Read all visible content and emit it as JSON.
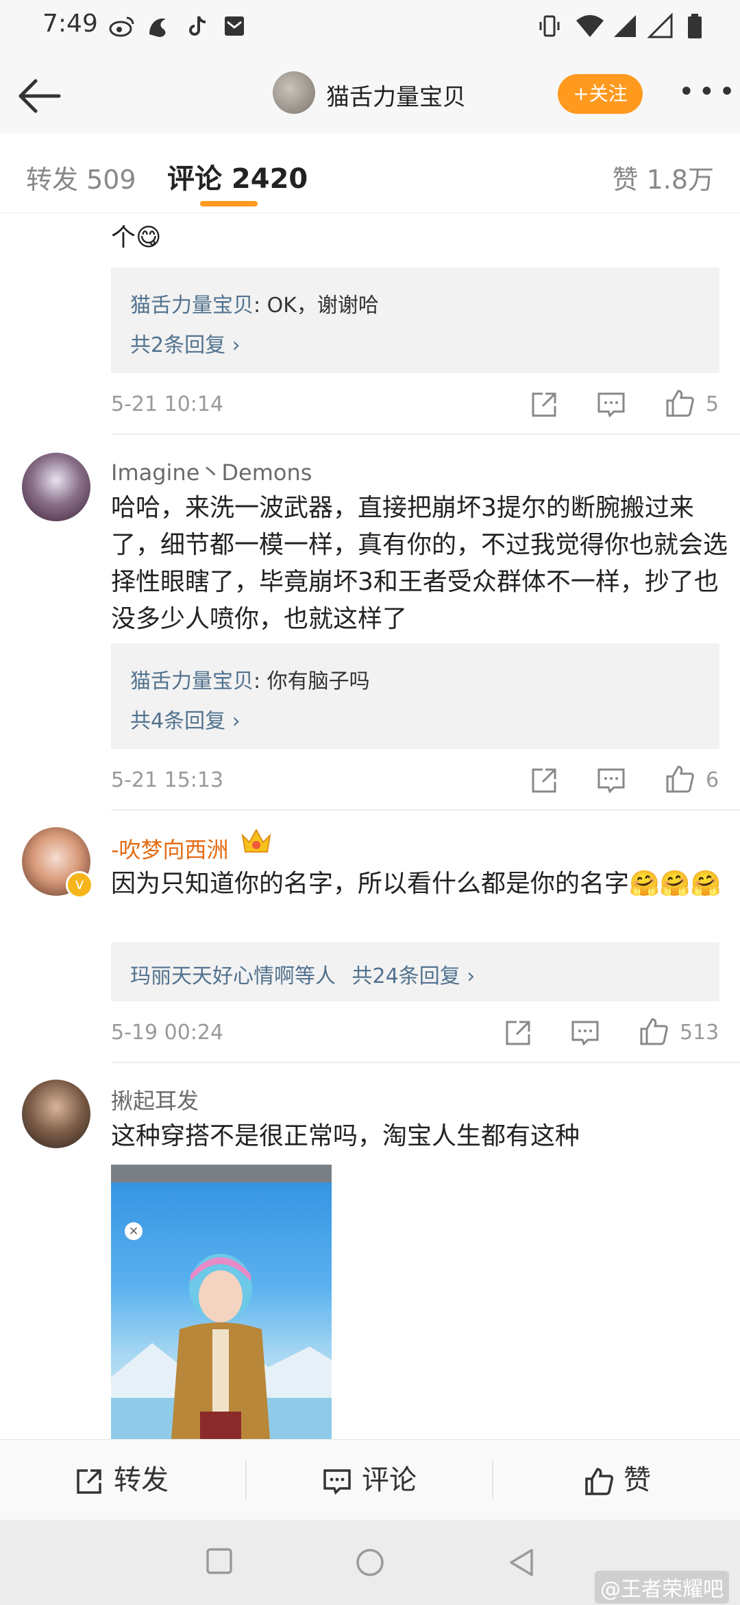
{
  "status_bar": {
    "time": "7:49",
    "icons": [
      "weibo-icon",
      "uc-icon",
      "tiktok-icon",
      "mail-icon",
      "vibrate-icon",
      "wifi-icon",
      "signal-icon",
      "signal-empty-icon",
      "battery-icon"
    ]
  },
  "header": {
    "title": "猫舌力量宝贝",
    "follow_label": "+关注",
    "more_label": "•••"
  },
  "tabs": {
    "repost": "转发 509",
    "comment": "评论 2420",
    "likes": "赞 1.8万"
  },
  "accent_color": "#ff9a1f",
  "link_color": "#52728f",
  "comments": [
    {
      "text_partial": "个😋",
      "reply_user": "猫舌力量宝贝",
      "reply_text": ": OK，谢谢哈",
      "reply_more": "共2条回复 ›",
      "date": "5-21 10:14",
      "likes": "5"
    },
    {
      "name": "Imagine丶Demons",
      "text": "哈哈，来洗一波武器，直接把崩坏3提尔的断腕搬过来了，细节都一模一样，真有你的，不过我觉得你也就会选择性眼瞎了，毕竟崩坏3和王者受众群体不一样，抄了也没多少人喷你，也就这样了",
      "reply_user": "猫舌力量宝贝",
      "reply_text": ": 你有脑子吗",
      "reply_more": "共4条回复 ›",
      "date": "5-21 15:13",
      "likes": "6"
    },
    {
      "name": "-吹梦向西洲",
      "text": "因为只知道你的名字，所以看什么都是你的名字🤗🤗🤗",
      "reply_summary_user": "玛丽天天好心情啊",
      "reply_summary_mid": "等人",
      "reply_more": "共24条回复 ›",
      "date": "5-19 00:24",
      "likes": "513"
    },
    {
      "name": "揪起耳发",
      "text": "这种穿搭不是很正常吗，淘宝人生都有这种"
    }
  ],
  "bottom_bar": {
    "repost": "转发",
    "comment": "评论",
    "like": "赞"
  },
  "watermark": "@王者荣耀吧"
}
